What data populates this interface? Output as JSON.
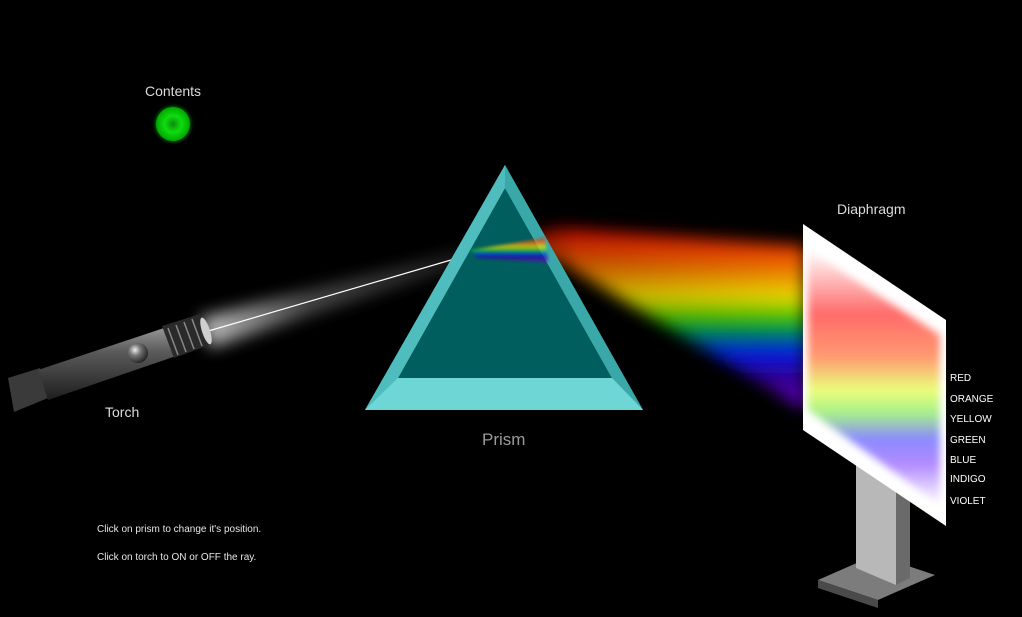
{
  "contents": {
    "label": "Contents"
  },
  "torch": {
    "label": "Torch",
    "ray_on": true
  },
  "prism": {
    "label": "Prism"
  },
  "diaphragm": {
    "label": "Diaphragm",
    "bands": [
      {
        "label": "RED",
        "color": "#ff0000"
      },
      {
        "label": "ORANGE",
        "color": "#ff8000"
      },
      {
        "label": "YELLOW",
        "color": "#ffff00"
      },
      {
        "label": "GREEN",
        "color": "#00ff00"
      },
      {
        "label": "BLUE",
        "color": "#0000ff"
      },
      {
        "label": "INDIGO",
        "color": "#4b0082"
      },
      {
        "label": "VIOLET",
        "color": "#8f00ff"
      }
    ]
  },
  "instructions": {
    "prism": "Click on prism to change it's position.",
    "torch": "Click on torch to ON or OFF the ray."
  },
  "colors": {
    "background": "#000000",
    "prism_face": "#005e5e",
    "prism_edge": "#5fcfcf",
    "contents_button": "#0fdc0f"
  }
}
